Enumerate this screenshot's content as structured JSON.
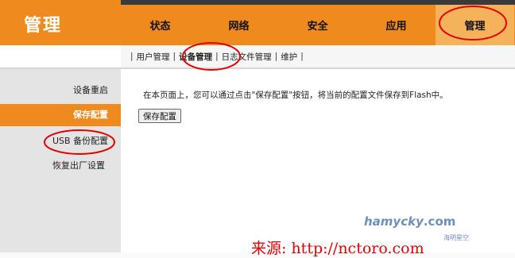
{
  "header": {
    "brand_title": "管理",
    "tabs": [
      {
        "label": "状态"
      },
      {
        "label": "网络"
      },
      {
        "label": "安全"
      },
      {
        "label": "应用"
      },
      {
        "label": "管理"
      }
    ]
  },
  "subnav": {
    "items": [
      {
        "label": "用户管理"
      },
      {
        "label": "设备管理"
      },
      {
        "label": "日志文件管理"
      },
      {
        "label": "维护"
      }
    ]
  },
  "sidebar": {
    "items": [
      {
        "label": "设备重启"
      },
      {
        "label": "保存配置"
      },
      {
        "label": "USB 备份配置"
      },
      {
        "label": "恢复出厂设置"
      }
    ]
  },
  "main": {
    "description": "在本页面上，您可以通过点击\"保存配置\"按钮，将当前的配置文件保存到Flash中。",
    "save_button": "保存配置"
  },
  "watermark": {
    "logo": "hamycky",
    "logo_suffix": ".com",
    "sub": "海明星空"
  },
  "source": "来源: http://nctoro.com",
  "colors": {
    "accent": "#ef8a1e",
    "accent_light": "#f4b25b",
    "annotation": "#e60000"
  }
}
